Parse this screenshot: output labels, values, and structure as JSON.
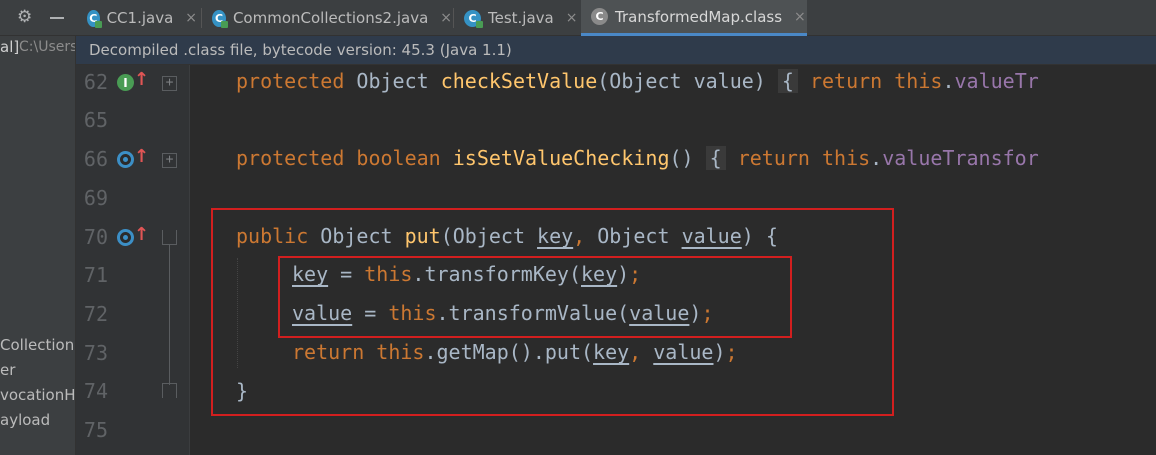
{
  "toolbar": {
    "settings_icon": "gear-icon",
    "hide_icon": "minus-icon"
  },
  "tabs": [
    {
      "label": "CC1.java",
      "close": "×",
      "icon": "java-class-icon"
    },
    {
      "label": "CommonCollections2.java",
      "close": "×",
      "icon": "java-class-icon"
    },
    {
      "label": "Test.java",
      "close": "×",
      "icon": "java-class-icon"
    },
    {
      "label": "TransformedMap.class",
      "close": "×",
      "icon": "class-file-icon",
      "active": true
    }
  ],
  "project_panel": {
    "root_label": "al]",
    "root_path": "C:\\Users",
    "items": [
      "Collections.",
      "er",
      "vocationH",
      "ayload"
    ]
  },
  "banner": {
    "text": "Decompiled .class file, bytecode version: 45.3 (Java 1.1)"
  },
  "gutter": {
    "line_numbers": [
      "62",
      "65",
      "66",
      "69",
      "70",
      "71",
      "72",
      "73",
      "74",
      "75"
    ],
    "impl_glyph": "I",
    "arrow_glyph": "↑"
  },
  "code": {
    "l62": {
      "kw1": "protected ",
      "t1": "Object ",
      "fn": "checkSetValue",
      "p1": "(Object value) ",
      "brace": "{",
      "kw2": " return ",
      "kw3": "this",
      "t2": ".",
      "fld": "valueTr"
    },
    "l66": {
      "kw1": "protected boolean ",
      "fn": "isSetValueChecking",
      "p1": "() ",
      "brace": "{",
      "kw2": " return ",
      "kw3": "this",
      "t2": ".",
      "fld": "valueTransfor"
    },
    "l70": {
      "kw1": "public ",
      "t1": "Object ",
      "fn": "put",
      "p1": "(Object ",
      "a1": "key",
      "c1": ", ",
      "p2": "Object ",
      "a2": "value",
      "p3": ") {"
    },
    "l71": {
      "a1": "key",
      "t1": " = ",
      "kw1": "this",
      "t2": ".transformKey(",
      "a2": "key",
      "t3": ")",
      "semi": ";"
    },
    "l72": {
      "a1": "value",
      "t1": " = ",
      "kw1": "this",
      "t2": ".transformValue(",
      "a2": "value",
      "t3": ")",
      "semi": ";"
    },
    "l73": {
      "kw1": "return ",
      "kw2": "this",
      "t1": ".getMap().put(",
      "a1": "key",
      "c1": ", ",
      "a2": "value",
      "t2": ")",
      "semi": ";"
    },
    "l74": {
      "t1": "}"
    }
  },
  "colors": {
    "highlight_box": "#d21f1f",
    "keyword": "#cc7832",
    "method": "#ffc66d",
    "field": "#9876aa",
    "text": "#a9b7c6",
    "background": "#2b2b2b"
  }
}
